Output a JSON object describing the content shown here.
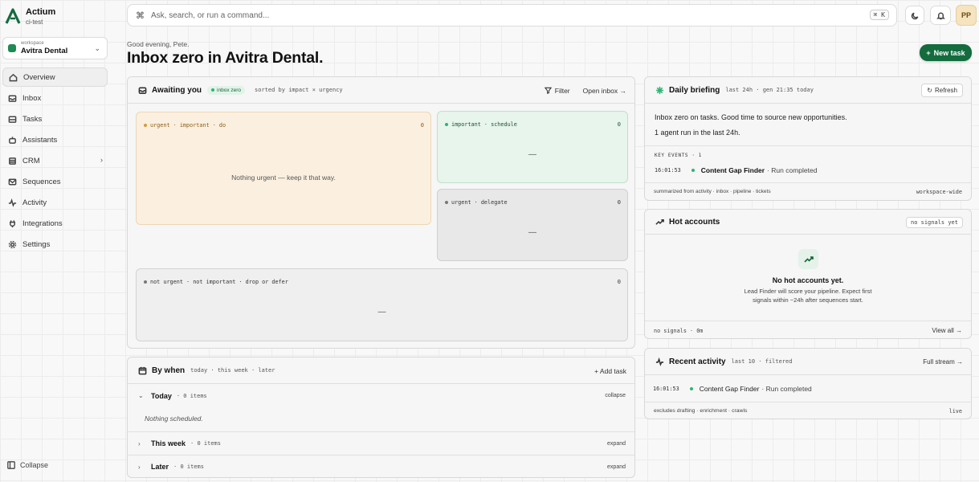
{
  "brand": {
    "name": "Actium",
    "sub": "ci-test"
  },
  "workspace": {
    "label": "workspace",
    "name": "Avitra Dental"
  },
  "nav": {
    "overview": "Overview",
    "inbox": "Inbox",
    "tasks": "Tasks",
    "assistants": "Assistants",
    "crm": "CRM",
    "sequences": "Sequences",
    "activity": "Activity",
    "integrations": "Integrations",
    "settings": "Settings",
    "collapse": "Collapse"
  },
  "command": {
    "placeholder": "Ask, search, or run a command...",
    "shortcut": "⌘ K"
  },
  "user": {
    "initials": "PP"
  },
  "header": {
    "greeting": "Good evening, Pete.",
    "title": "Inbox zero in Avitra Dental.",
    "new_task": "New task"
  },
  "awaiting": {
    "title": "Awaiting you",
    "badge": "inbox zero",
    "sort": "sorted by impact × urgency",
    "filter": "Filter",
    "open_inbox": "Open inbox",
    "q1_label": "urgent · important · do",
    "q1_count": "0",
    "q1_empty": "Nothing urgent — keep it that way.",
    "q2_label": "important · schedule",
    "q2_count": "0",
    "q2_empty": "—",
    "q3_label": "urgent · delegate",
    "q3_count": "0",
    "q3_empty": "—",
    "q4_label": "not urgent · not important · drop or defer",
    "q4_count": "0",
    "q4_empty": "—"
  },
  "by_when": {
    "title": "By when",
    "meta": "today · this week · later",
    "add_task": "Add task",
    "today": {
      "title": "Today",
      "count": "· 0 items",
      "action": "collapse",
      "empty": "Nothing scheduled."
    },
    "week": {
      "title": "This week",
      "count": "· 0 items",
      "action": "expand"
    },
    "later": {
      "title": "Later",
      "count": "· 0 items",
      "action": "expand"
    }
  },
  "briefing": {
    "title": "Daily briefing",
    "meta": "last 24h · gen 21:35 today",
    "refresh": "Refresh",
    "line1": "Inbox zero on tasks. Good time to source new opportunities.",
    "line2": "1 agent run in the last 24h.",
    "key_events": "KEY EVENTS · 1",
    "event_time": "16:01:53",
    "event_agent": "Content Gap Finder",
    "event_status": "· Run completed",
    "footer_left": "summarized from activity · inbox · pipeline · tickets",
    "footer_right": "workspace-wide"
  },
  "hot": {
    "title": "Hot accounts",
    "chip": "no signals yet",
    "empty_title": "No hot accounts yet.",
    "empty_line1": "Lead Finder will score your pipeline. Expect first",
    "empty_line2": "signals within ~24h after sequences start.",
    "footer_left": "no signals · 0m",
    "view_all": "View all →"
  },
  "recent": {
    "title": "Recent activity",
    "meta": "last 10 · filtered",
    "full_stream": "Full stream",
    "row_time": "16:01:53",
    "row_agent": "Content Gap Finder",
    "row_status": "· Run completed",
    "footer_left": "excludes drafting · enrichment · crawls",
    "footer_right": "live"
  },
  "colors": {
    "accent": "#136b3e",
    "success": "#2bb673",
    "warn": "#c9861a"
  },
  "icons": [
    "command-icon",
    "moon-icon",
    "bell-icon",
    "inbox-icon",
    "pulse-icon",
    "trend-icon",
    "calendar-icon",
    "refresh-icon",
    "filter-icon"
  ]
}
